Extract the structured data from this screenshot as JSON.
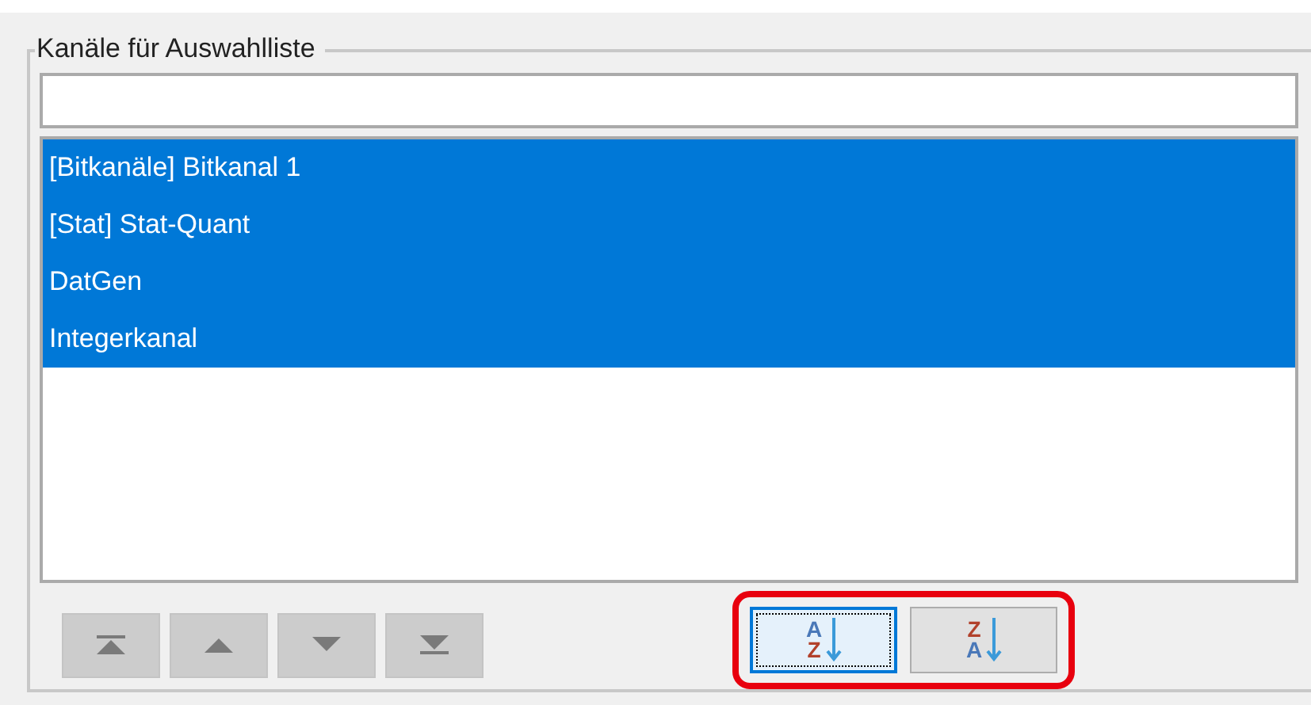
{
  "group": {
    "title": "Kanäle für Auswahlliste"
  },
  "channels": [
    {
      "label": "[Bitkanäle] Bitkanal 1",
      "selected": true
    },
    {
      "label": "[Stat] Stat-Quant",
      "selected": true
    },
    {
      "label": "DatGen",
      "selected": true
    },
    {
      "label": "Integerkanal",
      "selected": true
    }
  ],
  "move_buttons": [
    {
      "kind": "top",
      "disabled": true
    },
    {
      "kind": "up",
      "disabled": true
    },
    {
      "kind": "down",
      "disabled": true
    },
    {
      "kind": "bottom",
      "disabled": true
    }
  ],
  "sort_buttons": [
    {
      "first": "A",
      "second": "Z",
      "focused": true
    },
    {
      "first": "Z",
      "second": "A",
      "focused": false
    }
  ]
}
